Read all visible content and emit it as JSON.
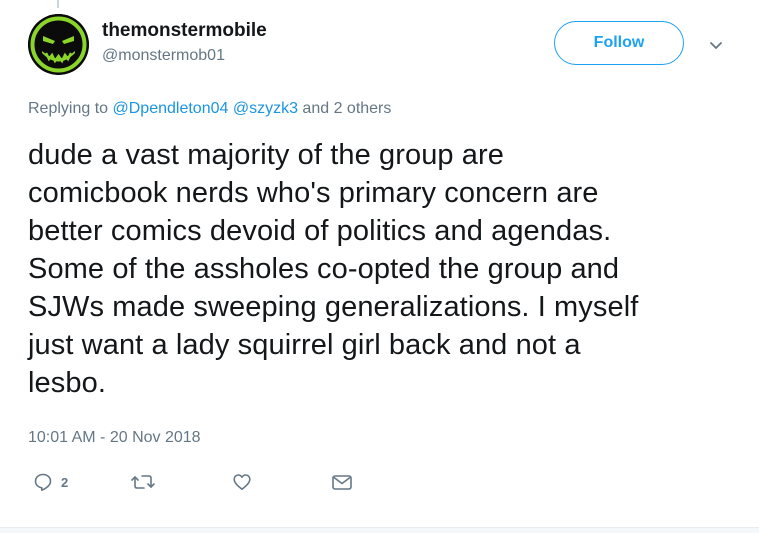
{
  "author": {
    "display_name": "themonstermobile",
    "handle": "@monstermob01",
    "avatar_icon": "monster-face-avatar"
  },
  "header": {
    "follow_label": "Follow",
    "menu_icon": "chevron-down-icon"
  },
  "reply_context": {
    "prefix": "Replying to ",
    "mention_1": "@Dpendleton04",
    "mention_2": "@szyzk3",
    "suffix": " and 2 others"
  },
  "tweet": {
    "text": "dude a vast majority of the group are\ncomicbook nerds who's primary concern are\nbetter comics devoid of politics and agendas.\nSome of the assholes co-opted the group and\nSJWs made sweeping generalizations. I myself\njust want a lady squirrel girl back and not a\nlesbo.",
    "timestamp": "10:01 AM - 20 Nov 2018"
  },
  "actions": {
    "reply_count": "2",
    "reply_icon": "reply-icon",
    "retweet_icon": "retweet-icon",
    "like_icon": "heart-icon",
    "dm_icon": "envelope-icon"
  },
  "colors": {
    "accent": "#1da1f2",
    "link": "#1b95e0",
    "secondary_text": "#657786",
    "primary_text": "#14171a",
    "avatar_green": "#8bd52a"
  }
}
